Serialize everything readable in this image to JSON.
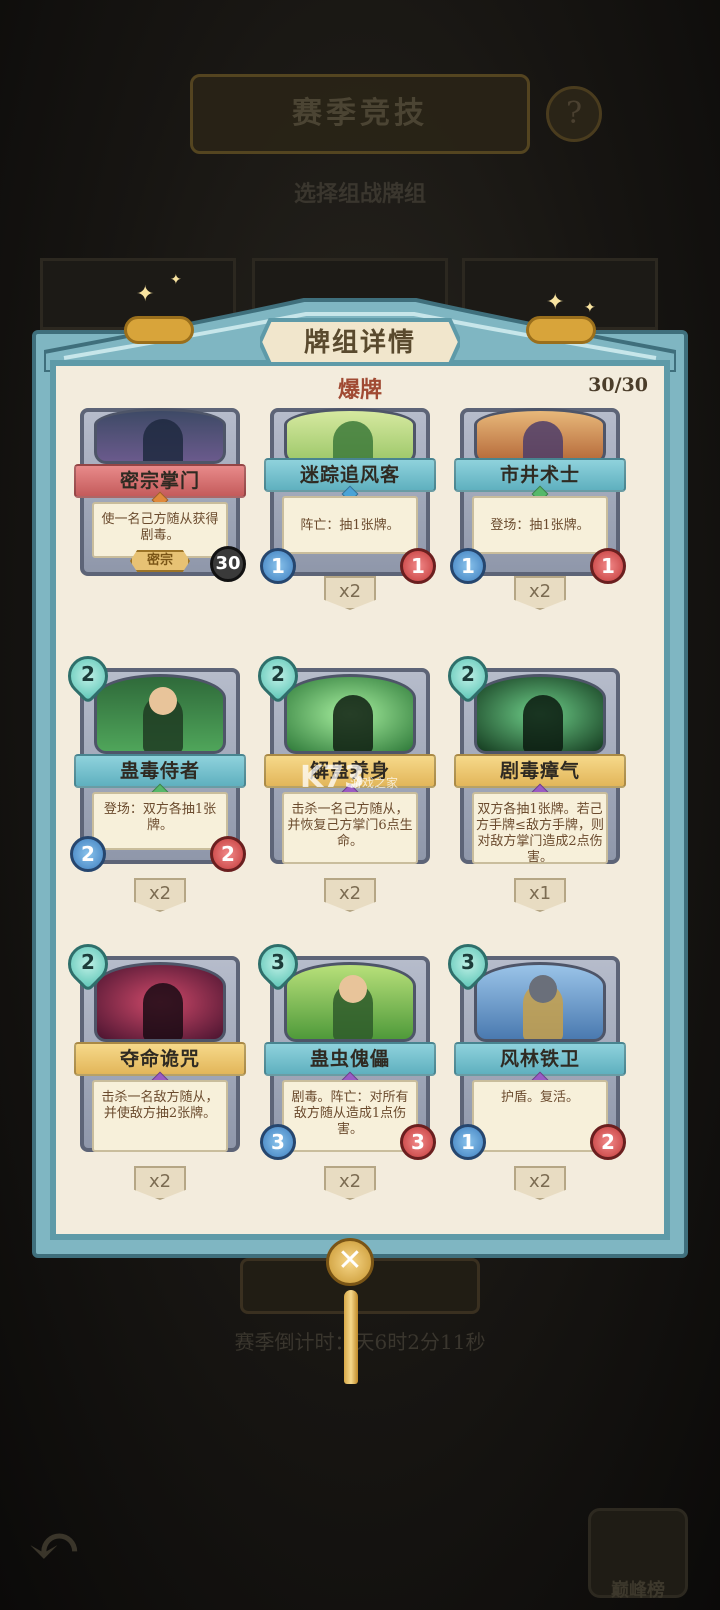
{
  "background": {
    "title": "赛季竞技",
    "subtitle": "选择组战牌组",
    "help": "?",
    "timer": "赛季倒计时：天6时2分11秒",
    "rank_label": "巅峰榜"
  },
  "modal": {
    "title": "牌组详情",
    "deck_name": "爆牌",
    "deck_count": "30/30",
    "close_symbol": "✕"
  },
  "cards": [
    {
      "name": "密宗掌门",
      "text": "使一名己方随从获得剧毒。",
      "rarity": "密宗",
      "ult": "30",
      "banner": "red",
      "gem": "#e08a3c"
    },
    {
      "name": "迷踪追风客",
      "text": "阵亡：抽1张牌。",
      "attack": "1",
      "health": "1",
      "copies": "x2",
      "banner": "teal",
      "gem": "#4aa3d6"
    },
    {
      "name": "市井术士",
      "text": "登场：抽1张牌。",
      "attack": "1",
      "health": "1",
      "copies": "x2",
      "banner": "teal",
      "gem": "#56b86a"
    },
    {
      "name": "蛊毒侍者",
      "cost": "2",
      "text": "登场：双方各抽1张牌。",
      "attack": "2",
      "health": "2",
      "copies": "x2",
      "banner": "teal",
      "gem": "#56b86a"
    },
    {
      "name": "解蛊养身",
      "cost": "2",
      "text": "击杀一名己方随从，并恢复己方掌门6点生命。",
      "copies": "x2",
      "banner": "gold",
      "gem": "#9a5bc4"
    },
    {
      "name": "剧毒瘴气",
      "cost": "2",
      "text": "双方各抽1张牌。若己方手牌≤敌方手牌，则对敌方掌门造成2点伤害。",
      "copies": "x1",
      "banner": "gold",
      "gem": "#9a5bc4"
    },
    {
      "name": "夺命诡咒",
      "cost": "2",
      "text": "击杀一名敌方随从，并使敌方抽2张牌。",
      "copies": "x2",
      "banner": "gold",
      "gem": "#9a5bc4"
    },
    {
      "name": "蛊虫傀儡",
      "cost": "3",
      "text": "剧毒。阵亡：对所有敌方随从造成1点伤害。",
      "attack": "3",
      "health": "3",
      "copies": "x2",
      "banner": "teal",
      "gem": "#9a5bc4"
    },
    {
      "name": "风林铁卫",
      "cost": "3",
      "text": "护盾。复活。",
      "attack": "1",
      "health": "2",
      "copies": "x2",
      "banner": "teal",
      "gem": "#9a5bc4"
    }
  ],
  "watermark": {
    "logo": "K73",
    "sub": "游戏之家"
  }
}
